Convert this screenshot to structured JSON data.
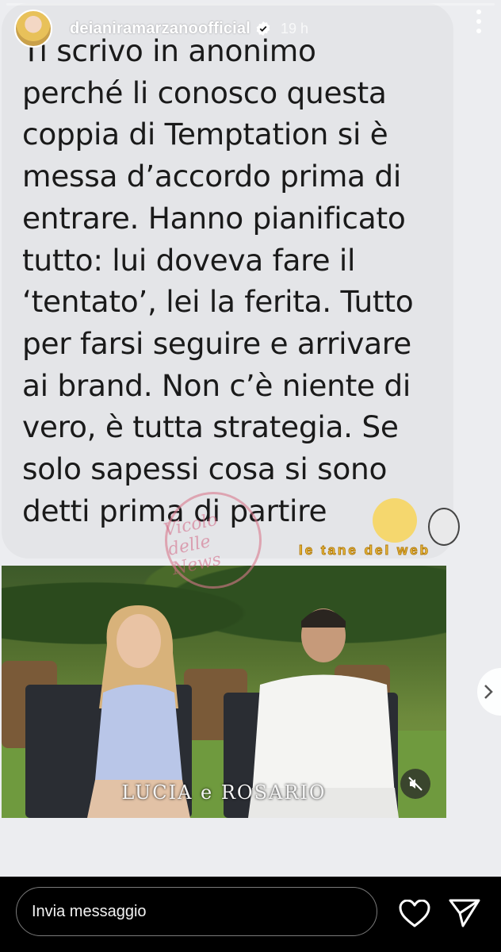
{
  "header": {
    "username": "deianiramarzanoofficial",
    "time": "19 h"
  },
  "message": {
    "text": "Ti scrivo in anonimo\nperché li conosco questa\ncoppia di Temptation si è\nmessa d’accordo prima di\nentrare. Hanno pianificato\ntutto: lui doveva fare il\n‘tentato’, lei la ferita. Tutto\nper farsi seguire e arrivare\nai brand. Non c’è niente di\nvero, è tutta strategia. Se\nsolo sapessi cosa si sono\ndetti prima di partire"
  },
  "video": {
    "caption": "LUCIA e ROSARIO"
  },
  "watermark": {
    "stamp": "Vicolo delle News",
    "banner": "le tane del web"
  },
  "footer": {
    "input_placeholder": "Invia messaggio"
  },
  "colors": {
    "story_background": "#ecedf0",
    "bubble": "#e4e5e8",
    "bottom_bar": "#000000"
  },
  "icons": [
    "verified-badge-icon",
    "more-icon",
    "mute-icon",
    "heart-icon",
    "send-icon",
    "chevron-right-icon"
  ]
}
